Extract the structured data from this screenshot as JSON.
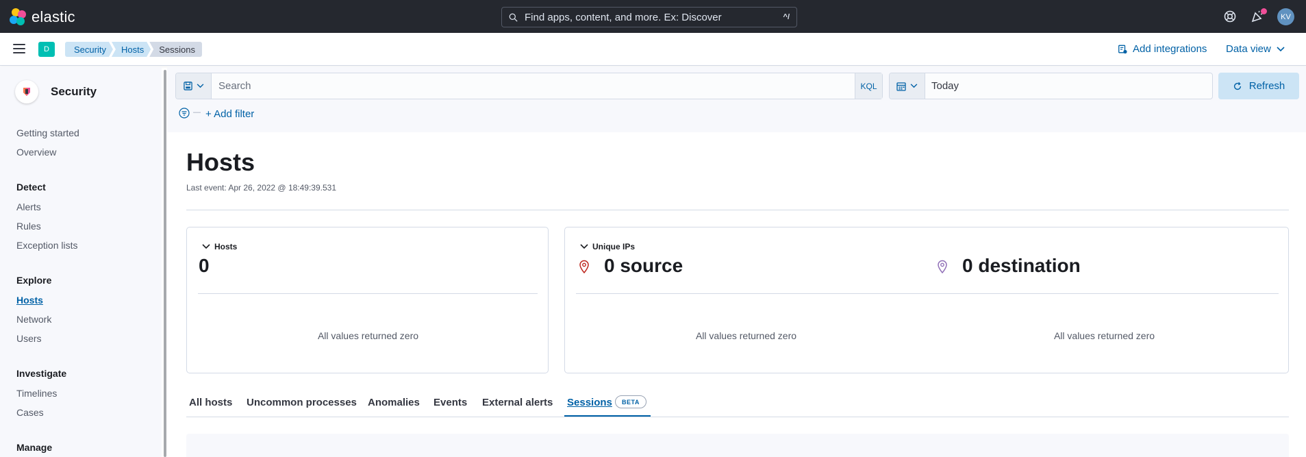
{
  "header": {
    "brand": "elastic",
    "search_placeholder": "Find apps, content, and more. Ex: Discover",
    "search_shortcut": "^/",
    "avatar_initials": "KV"
  },
  "subbar": {
    "space_initial": "D",
    "breadcrumbs": [
      "Security",
      "Hosts",
      "Sessions"
    ],
    "add_integrations": "Add integrations",
    "data_view": "Data view"
  },
  "sidebar": {
    "title": "Security",
    "items": [
      {
        "label": "Getting started"
      },
      {
        "label": "Overview"
      }
    ],
    "groups": [
      {
        "title": "Detect",
        "items": [
          "Alerts",
          "Rules",
          "Exception lists"
        ]
      },
      {
        "title": "Explore",
        "items": [
          "Hosts",
          "Network",
          "Users"
        ],
        "active": "Hosts"
      },
      {
        "title": "Investigate",
        "items": [
          "Timelines",
          "Cases"
        ]
      },
      {
        "title": "Manage",
        "items": []
      }
    ]
  },
  "query": {
    "search_placeholder": "Search",
    "language": "KQL",
    "date": "Today",
    "refresh_label": "Refresh",
    "add_filter": "+ Add filter"
  },
  "page": {
    "title": "Hosts",
    "last_event": "Last event: Apr 26, 2022 @ 18:49:39.531"
  },
  "kpi": {
    "hosts": {
      "label": "Hosts",
      "value": "0",
      "empty": "All values returned zero"
    },
    "unique_ips": {
      "label": "Unique IPs",
      "source": "0 source",
      "destination": "0 destination",
      "source_empty": "All values returned zero",
      "destination_empty": "All values returned zero"
    }
  },
  "tabs": [
    "All hosts",
    "Uncommon processes",
    "Anomalies",
    "Events",
    "External alerts",
    "Sessions"
  ],
  "active_tab": "Sessions",
  "beta_badge": "BETA",
  "colors": {
    "accent": "#0061a6",
    "header_bg": "#25282f",
    "pin": "#bd271e",
    "pin_alt": "#9170b8"
  }
}
